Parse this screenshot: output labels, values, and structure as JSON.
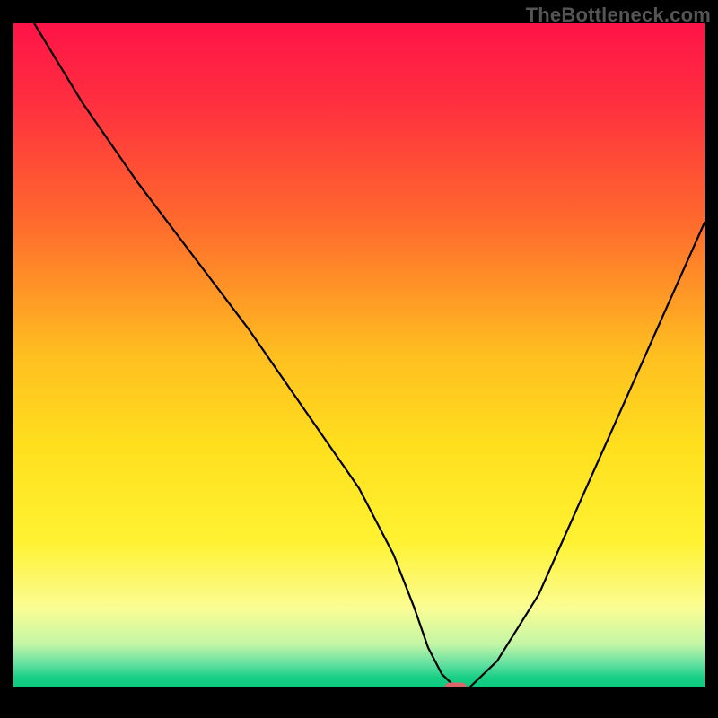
{
  "watermark": "TheBottleneck.com",
  "chart_data": {
    "type": "line",
    "title": "",
    "xlabel": "",
    "ylabel": "",
    "xlim": [
      0,
      100
    ],
    "ylim": [
      0,
      100
    ],
    "grid": false,
    "background": {
      "type": "vertical-gradient",
      "stops": [
        {
          "pos": 0.0,
          "color": "#ff1448"
        },
        {
          "pos": 0.12,
          "color": "#ff2f3f"
        },
        {
          "pos": 0.3,
          "color": "#ff6a2d"
        },
        {
          "pos": 0.5,
          "color": "#ffbf20"
        },
        {
          "pos": 0.64,
          "color": "#ffe01e"
        },
        {
          "pos": 0.78,
          "color": "#fff232"
        },
        {
          "pos": 0.88,
          "color": "#fbfd93"
        },
        {
          "pos": 0.935,
          "color": "#c3f6a6"
        },
        {
          "pos": 0.965,
          "color": "#62e0a0"
        },
        {
          "pos": 0.985,
          "color": "#18cf85"
        },
        {
          "pos": 1.0,
          "color": "#09c97f"
        }
      ]
    },
    "series": [
      {
        "name": "bottleneck-curve",
        "stroke": "#000000",
        "stroke_width": 2.2,
        "x": [
          3,
          10,
          18,
          26,
          34,
          42,
          50,
          55,
          58,
          60,
          62,
          64,
          66,
          70,
          76,
          82,
          88,
          94,
          100
        ],
        "y": [
          100,
          88,
          76,
          65,
          54,
          42,
          30,
          20,
          12,
          6,
          2,
          0,
          0,
          4,
          14,
          28,
          42,
          56,
          70
        ]
      }
    ],
    "marker": {
      "name": "optimal-point",
      "shape": "rounded-rect",
      "x": 64,
      "y": 0,
      "w_pct": 3.2,
      "h_pct": 1.5,
      "color": "#d8666b"
    }
  }
}
